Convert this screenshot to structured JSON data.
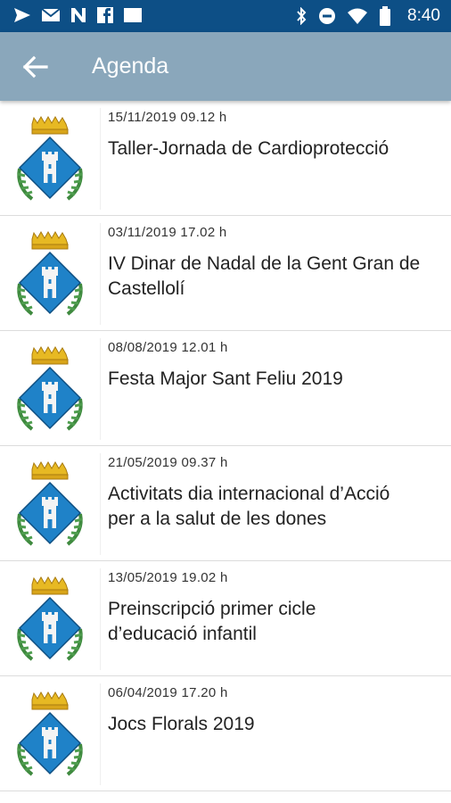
{
  "status_bar": {
    "time": "8:40",
    "left_icons": [
      "send-icon",
      "mail-icon",
      "n-app-icon",
      "facebook-icon",
      "square-icon"
    ],
    "right_icons": [
      "bluetooth-icon",
      "do-not-disturb-icon",
      "wifi-icon",
      "battery-icon"
    ]
  },
  "app_bar": {
    "title": "Agenda",
    "color": "#8aa7bb"
  },
  "items": [
    {
      "date": "15/11/2019 09.12 h",
      "title_lines": [
        "Taller-Jornada de Cardioprotecció"
      ]
    },
    {
      "date": "03/11/2019 17.02 h",
      "title_lines": [
        "IV Dinar de Nadal de la Gent Gran de",
        "Castellolí"
      ]
    },
    {
      "date": "08/08/2019 12.01 h",
      "title_lines": [
        "Festa Major Sant Feliu 2019"
      ]
    },
    {
      "date": "21/05/2019 09.37 h",
      "title_lines": [
        "Activitats dia internacional d’Acció",
        "per a la salut de les dones"
      ]
    },
    {
      "date": "13/05/2019 19.02 h",
      "title_lines": [
        "Preinscripció primer cicle",
        "d’educació infantil"
      ]
    },
    {
      "date": "06/04/2019 17.20 h",
      "title_lines": [
        "Jocs Florals 2019"
      ]
    }
  ]
}
